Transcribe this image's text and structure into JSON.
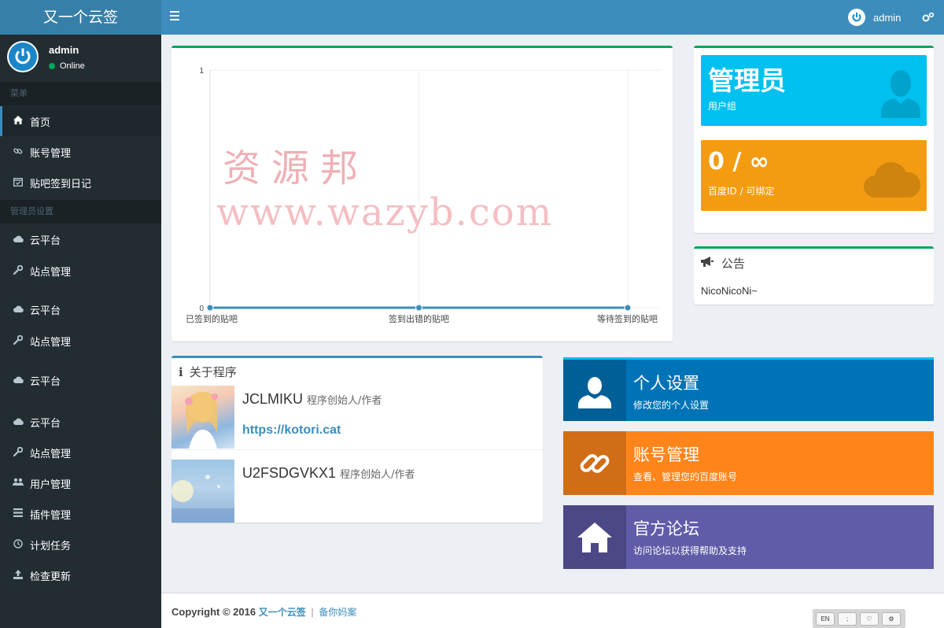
{
  "header": {
    "logo": "又一个云签",
    "username": "admin"
  },
  "sidebar": {
    "user": {
      "name": "admin",
      "status": "Online"
    },
    "sections": [
      {
        "header": "菜单"
      },
      {
        "header": "管理员设置"
      }
    ],
    "items": [
      {
        "label": "首页",
        "icon": "home-icon",
        "active": true
      },
      {
        "label": "账号管理",
        "icon": "link-icon"
      },
      {
        "label": "贴吧签到日记",
        "icon": "calendar-check-icon"
      },
      {
        "label": "云平台",
        "icon": "cloud-icon"
      },
      {
        "label": "站点管理",
        "icon": "wrench-icon"
      },
      {
        "label": "云平台",
        "icon": "cloud-icon"
      },
      {
        "label": "站点管理",
        "icon": "wrench-icon"
      },
      {
        "label": "云平台",
        "icon": "cloud-icon"
      },
      {
        "label": "云平台",
        "icon": "cloud-icon"
      },
      {
        "label": "站点管理",
        "icon": "wrench-icon"
      },
      {
        "label": "用户管理",
        "icon": "users-icon"
      },
      {
        "label": "插件管理",
        "icon": "list-icon"
      },
      {
        "label": "计划任务",
        "icon": "clock-icon"
      },
      {
        "label": "检查更新",
        "icon": "upload-icon"
      }
    ]
  },
  "chart_data": {
    "type": "line",
    "categories": [
      "已签到的贴吧",
      "签到出错的贴吧",
      "等待签到的贴吧"
    ],
    "series": [
      {
        "values": [
          0,
          0,
          0
        ]
      }
    ],
    "ylim": [
      0,
      1
    ],
    "yticks": [
      0,
      1
    ],
    "grid": true,
    "color": "#3c8dbc"
  },
  "watermark": {
    "line1": "资源邦",
    "line2": "www.wazyb.com"
  },
  "info_boxes": [
    {
      "title": "管理员",
      "subtitle": "用户组",
      "color": "#00c0ef",
      "icon": "user-icon"
    },
    {
      "title": "0 / ∞",
      "subtitle": "百度ID / 可绑定",
      "color": "#f39c12",
      "icon": "cloud-icon"
    }
  ],
  "notice": {
    "title": "公告",
    "text": "NicoNicoNi~"
  },
  "about": {
    "title": "关于程序",
    "authors": [
      {
        "name": "JCLMIKU",
        "role": "程序创始人/作者",
        "link": "https://kotori.cat"
      },
      {
        "name": "U2FSDGVKX1",
        "role": "程序创始人/作者"
      }
    ]
  },
  "actions": [
    {
      "title": "个人设置",
      "subtitle": "修改您的个人设置",
      "icon": "user-icon",
      "color": "#0073b7"
    },
    {
      "title": "账号管理",
      "subtitle": "查看、管理您的百度账号",
      "icon": "link-icon",
      "color": "#ff851b"
    },
    {
      "title": "官方论坛",
      "subtitle": "访问论坛以获得帮助及支持",
      "icon": "home-icon",
      "color": "#605ca8"
    }
  ],
  "footer": {
    "copyright": "Copyright © 2016",
    "site_link": "又一个云签",
    "separator": "|",
    "beian_link": "备你妈案"
  },
  "toolbar": {
    "buttons": [
      "EN",
      ";",
      "♡",
      "⚙"
    ]
  }
}
